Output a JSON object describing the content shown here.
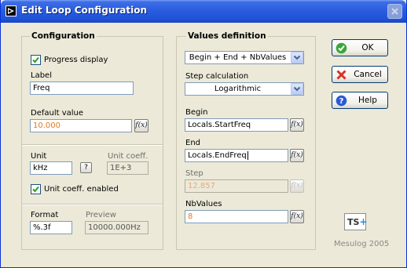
{
  "window": {
    "title": "Edit Loop Configuration",
    "app_icon": "labview-arrow-icon",
    "close_icon": "close-icon"
  },
  "configuration": {
    "group_title": "Configuration",
    "progress_display": {
      "label": "Progress display",
      "checked": true
    },
    "label_caption": "Label",
    "label_value": "Freq",
    "default_caption": "Default value",
    "default_value": "10.000",
    "unit_caption": "Unit",
    "unit_value": "kHz",
    "unit_help": "?",
    "unit_coeff_caption": "Unit coeff.",
    "unit_coeff_value": "1E+3",
    "unit_coeff_enabled": {
      "label": "Unit coeff. enabled",
      "checked": true
    },
    "format_caption": "Format",
    "format_value": "%.3f",
    "preview_caption": "Preview",
    "preview_value": "10000.000Hz"
  },
  "values_definition": {
    "group_title": "Values definition",
    "mode_selected": "Begin + End + NbValues",
    "step_calc_caption": "Step calculation",
    "step_calc_selected": "Logarithmic",
    "begin_caption": "Begin",
    "begin_value": "Locals.StartFreq",
    "end_caption": "End",
    "end_value": "Locals.EndFreq",
    "step_caption": "Step",
    "step_value": "12.857",
    "nbvalues_caption": "NbValues",
    "nbvalues_value": "8"
  },
  "expression_button_label": "f(x)",
  "buttons": {
    "ok": "OK",
    "cancel": "Cancel",
    "help": "Help"
  },
  "branding": {
    "logo_text": "TS",
    "logo_plus": "+",
    "company": "Mesulog 2005"
  },
  "colors": {
    "title_bar": "#2154d8",
    "value_orange": "#e07a1f",
    "ok_green": "#3aa63a",
    "cancel_red": "#d8322a",
    "help_blue": "#2a5bd6"
  }
}
